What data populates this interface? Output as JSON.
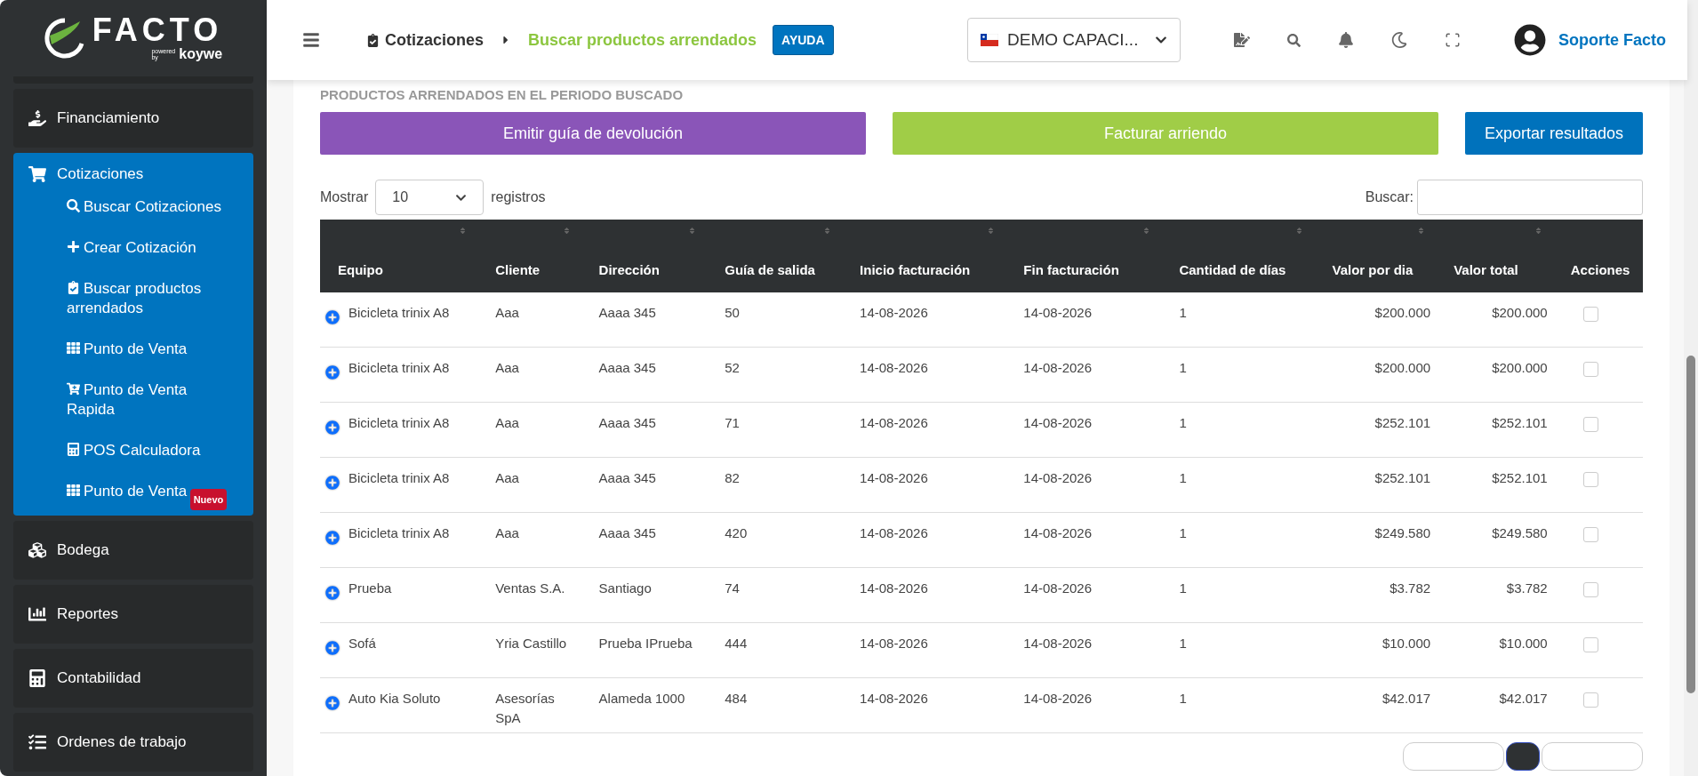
{
  "sidebar": {
    "brand": {
      "name": "FACTO",
      "powered": "powered",
      "by": "by",
      "partner": "koywe"
    },
    "items": [
      {
        "label": "Financiamiento",
        "expanded": false
      },
      {
        "label": "Cotizaciones",
        "expanded": true,
        "children": [
          {
            "label": "Buscar Cotizaciones"
          },
          {
            "label": "Crear Cotización"
          },
          {
            "label": "Buscar productos arrendados"
          },
          {
            "label": "Punto de Venta"
          },
          {
            "label": "Punto de Venta Rapida"
          },
          {
            "label": "POS Calculadora"
          },
          {
            "label": "Punto de Venta",
            "badge": "Nuevo"
          }
        ]
      },
      {
        "label": "Bodega",
        "expanded": false
      },
      {
        "label": "Reportes",
        "expanded": false
      },
      {
        "label": "Contabilidad",
        "expanded": false
      },
      {
        "label": "Ordenes de trabajo",
        "expanded": false
      }
    ]
  },
  "header": {
    "breadcrumb": [
      "Cotizaciones",
      "Buscar productos arrendados"
    ],
    "help": "AYUDA",
    "company": "DEMO CAPACI...",
    "user": "Soporte Facto"
  },
  "section_title": "PRODUCTOS ARRENDADOS EN EL PERIODO BUSCADO",
  "actions": [
    {
      "label": "Emitir guía de devolución",
      "color": "#8a55b8"
    },
    {
      "label": "Facturar arriendo",
      "color": "#a0cd47"
    },
    {
      "label": "Exportar resultados",
      "color": "#0072bc"
    }
  ],
  "table_controls": {
    "show": "Mostrar",
    "page_size": "10",
    "records": "registros",
    "search": "Buscar:"
  },
  "table": {
    "columns": [
      "Equipo",
      "Cliente",
      "Dirección",
      "Guía de salida",
      "Inicio facturación",
      "Fin facturación",
      "Cantidad de días",
      "Valor por dia",
      "Valor total",
      "Acciones"
    ],
    "rows": [
      {
        "cells": [
          "Bicicleta trinix A8",
          "Aaa",
          "Aaaa 345",
          "50",
          "14-08-2026",
          "14-08-2026",
          "1",
          "$200.000",
          "$200.000"
        ],
        "checked": false
      },
      {
        "cells": [
          "Bicicleta trinix A8",
          "Aaa",
          "Aaaa 345",
          "52",
          "14-08-2026",
          "14-08-2026",
          "1",
          "$200.000",
          "$200.000"
        ],
        "checked": false
      },
      {
        "cells": [
          "Bicicleta trinix A8",
          "Aaa",
          "Aaaa 345",
          "71",
          "14-08-2026",
          "14-08-2026",
          "1",
          "$252.101",
          "$252.101"
        ],
        "checked": false
      },
      {
        "cells": [
          "Bicicleta trinix A8",
          "Aaa",
          "Aaaa 345",
          "82",
          "14-08-2026",
          "14-08-2026",
          "1",
          "$252.101",
          "$252.101"
        ],
        "checked": false
      },
      {
        "cells": [
          "Bicicleta trinix A8",
          "Aaa",
          "Aaaa 345",
          "420",
          "14-08-2026",
          "14-08-2026",
          "1",
          "$249.580",
          "$249.580"
        ],
        "checked": false
      },
      {
        "cells": [
          "Prueba",
          "Ventas S.A.",
          "Santiago",
          "74",
          "14-08-2026",
          "14-08-2026",
          "1",
          "$3.782",
          "$3.782"
        ],
        "checked": false
      },
      {
        "cells": [
          "Sofá",
          "Yria Castillo",
          "Prueba IPrueba",
          "444",
          "14-08-2026",
          "14-08-2026",
          "1",
          "$10.000",
          "$10.000"
        ],
        "checked": false
      },
      {
        "cells": [
          "Auto Kia Soluto",
          "Asesorías SpA",
          "Alameda 1000",
          "484",
          "14-08-2026",
          "14-08-2026",
          "1",
          "$42.017",
          "$42.017"
        ],
        "checked": false
      }
    ]
  },
  "pagination": [
    {
      "selected": false
    },
    {
      "selected": true
    },
    {
      "selected": false
    }
  ]
}
